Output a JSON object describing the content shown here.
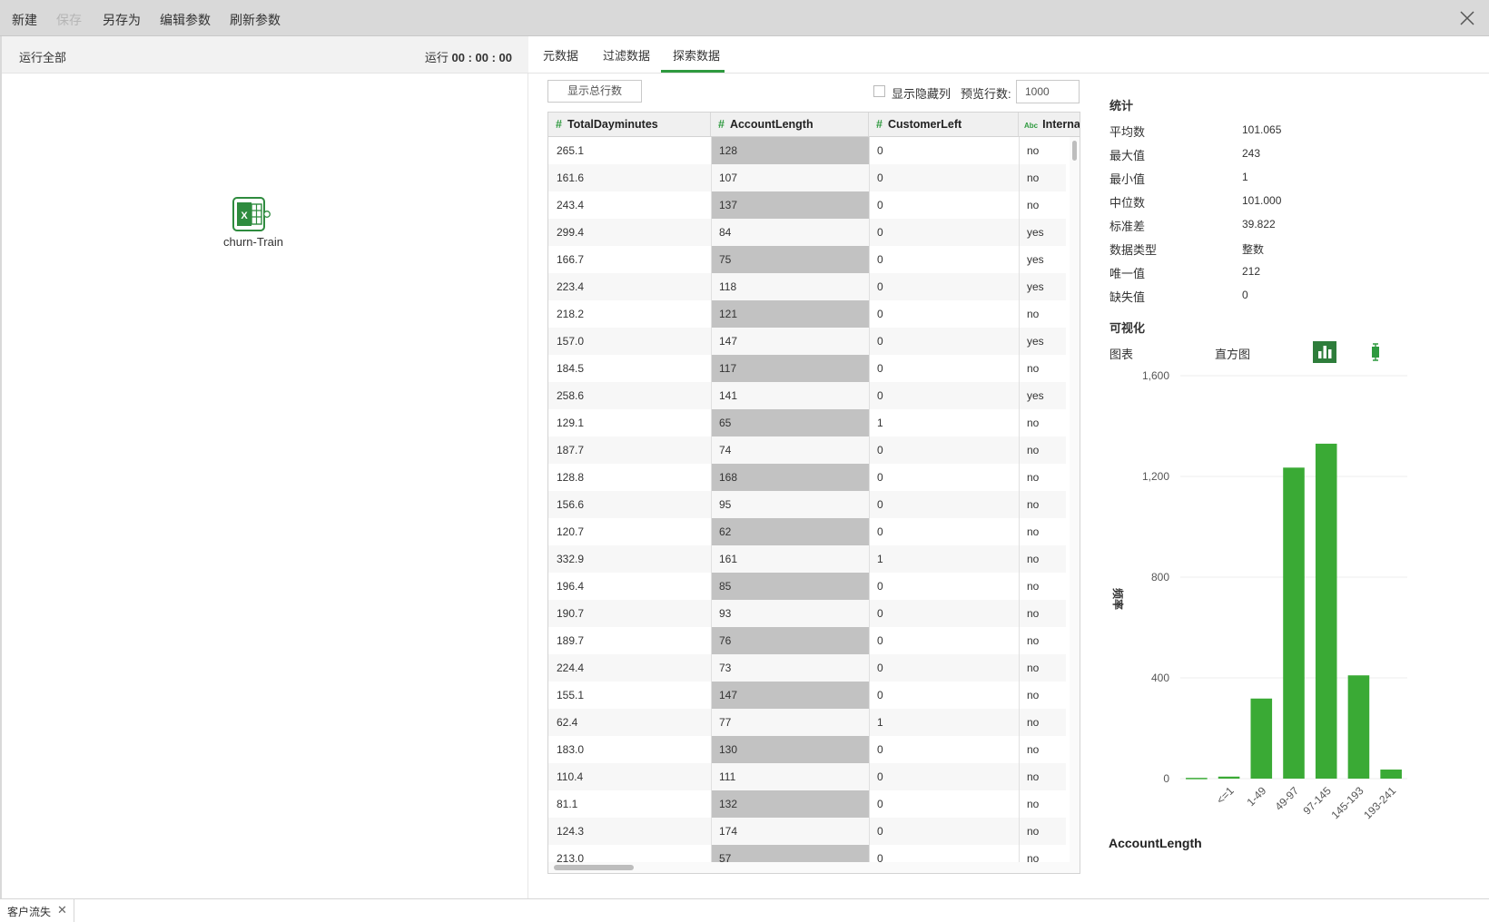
{
  "toolbar": {
    "new": "新建",
    "save": "保存",
    "save_as": "另存为",
    "edit_params": "编辑参数",
    "refresh_params": "刷新参数"
  },
  "left_panel": {
    "run_all": "运行全部",
    "run_time_label": "运行",
    "run_time_value": "00 : 00 : 00",
    "node_label": "churn-Train"
  },
  "tabs": [
    "元数据",
    "过滤数据",
    "探索数据"
  ],
  "controls": {
    "show_total_rows": "显示总行数",
    "show_hidden_cols": "显示隐藏列",
    "preview_rows_label": "预览行数:",
    "preview_rows_value": "1000"
  },
  "table": {
    "columns": [
      {
        "type": "#",
        "name": "TotalDayminutes"
      },
      {
        "type": "#",
        "name": "AccountLength"
      },
      {
        "type": "#",
        "name": "CustomerLeft"
      },
      {
        "type": "Abc",
        "name": "Interna"
      }
    ],
    "rows": [
      [
        "265.1",
        "128",
        "0",
        "no"
      ],
      [
        "161.6",
        "107",
        "0",
        "no"
      ],
      [
        "243.4",
        "137",
        "0",
        "no"
      ],
      [
        "299.4",
        "84",
        "0",
        "yes"
      ],
      [
        "166.7",
        "75",
        "0",
        "yes"
      ],
      [
        "223.4",
        "118",
        "0",
        "yes"
      ],
      [
        "218.2",
        "121",
        "0",
        "no"
      ],
      [
        "157.0",
        "147",
        "0",
        "yes"
      ],
      [
        "184.5",
        "117",
        "0",
        "no"
      ],
      [
        "258.6",
        "141",
        "0",
        "yes"
      ],
      [
        "129.1",
        "65",
        "1",
        "no"
      ],
      [
        "187.7",
        "74",
        "0",
        "no"
      ],
      [
        "128.8",
        "168",
        "0",
        "no"
      ],
      [
        "156.6",
        "95",
        "0",
        "no"
      ],
      [
        "120.7",
        "62",
        "0",
        "no"
      ],
      [
        "332.9",
        "161",
        "1",
        "no"
      ],
      [
        "196.4",
        "85",
        "0",
        "no"
      ],
      [
        "190.7",
        "93",
        "0",
        "no"
      ],
      [
        "189.7",
        "76",
        "0",
        "no"
      ],
      [
        "224.4",
        "73",
        "0",
        "no"
      ],
      [
        "155.1",
        "147",
        "0",
        "no"
      ],
      [
        "62.4",
        "77",
        "1",
        "no"
      ],
      [
        "183.0",
        "130",
        "0",
        "no"
      ],
      [
        "110.4",
        "111",
        "0",
        "no"
      ],
      [
        "81.1",
        "132",
        "0",
        "no"
      ],
      [
        "124.3",
        "174",
        "0",
        "no"
      ],
      [
        "213.0",
        "57",
        "0",
        "no"
      ]
    ]
  },
  "stats": {
    "title": "统计",
    "items": [
      {
        "label": "平均数",
        "value": "101.065"
      },
      {
        "label": "最大值",
        "value": "243"
      },
      {
        "label": "最小值",
        "value": "1"
      },
      {
        "label": "中位数",
        "value": "101.000"
      },
      {
        "label": "标准差",
        "value": "39.822"
      },
      {
        "label": "数据类型",
        "value": "整数"
      },
      {
        "label": "唯一值",
        "value": "212"
      },
      {
        "label": "缺失值",
        "value": "0"
      }
    ]
  },
  "viz": {
    "title": "可视化",
    "chart_label": "图表",
    "chart_type": "直方图",
    "bar_icon": "bar-chart-icon",
    "box_icon": "boxplot-icon"
  },
  "chart_data": {
    "type": "bar",
    "categories": [
      "",
      "<=1",
      "1-49",
      "49-97",
      "97-145",
      "145-193",
      "193-241"
    ],
    "values": [
      3,
      8,
      318,
      1235,
      1330,
      410,
      36
    ],
    "ylabel": "频率",
    "xlabel": "AccountLength",
    "ylim": [
      0,
      1600
    ],
    "yticks": [
      "0",
      "400",
      "800",
      "1,200",
      "1,600"
    ],
    "grid": true,
    "color": "#3aaa35"
  },
  "bottom_tab": {
    "label": "客户流失"
  },
  "colors": {
    "accent": "#2e9a3f",
    "bar": "#3aaa35",
    "highlight_col": "#c2c2c2"
  }
}
